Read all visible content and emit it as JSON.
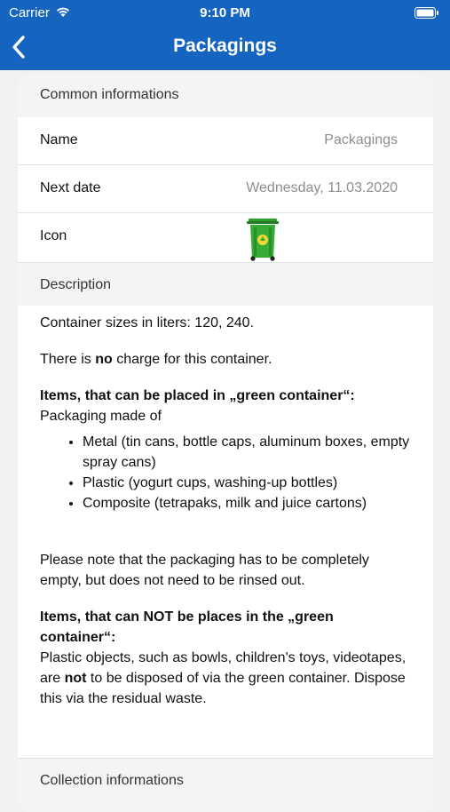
{
  "status_bar": {
    "carrier": "Carrier",
    "time": "9:10 PM"
  },
  "nav": {
    "title": "Packagings",
    "back_icon": "chevron-left-icon"
  },
  "common": {
    "header": "Common informations",
    "name_label": "Name",
    "name_value": "Packagings",
    "next_date_label": "Next date",
    "next_date_value": "Wednesday, 11.03.2020",
    "icon_label": "Icon",
    "icon_name": "green-recycling-bin-icon"
  },
  "description": {
    "header": "Description",
    "sizes": "Container sizes in liters: 120, 240.",
    "charge_prefix": "There is ",
    "charge_bold": "no",
    "charge_suffix": " charge for this container.",
    "allowed_heading": "Items, that can be placed in „green container“:",
    "allowed_intro": "Packaging made of",
    "allowed_items": [
      "Metal (tin cans, bottle caps, aluminum boxes, empty spray cans)",
      "Plastic (yogurt cups, washing-up bottles)",
      "Composite (tetrapaks, milk and juice cartons)"
    ],
    "note": "Please note that the packaging has to be completely empty, but does not need to be rinsed out.",
    "not_allowed_heading": "Items, that can NOT be places in the „green container“:",
    "not_allowed_prefix": "Plastic objects, such as bowls, children's toys, videotapes, are ",
    "not_allowed_bold": "not",
    "not_allowed_suffix": " to be disposed of via the green container. Dispose this via the residual waste."
  },
  "collection": {
    "header": "Collection informations"
  },
  "colors": {
    "nav_bar": "#1565c0",
    "bin_green": "#2e9e2e"
  }
}
